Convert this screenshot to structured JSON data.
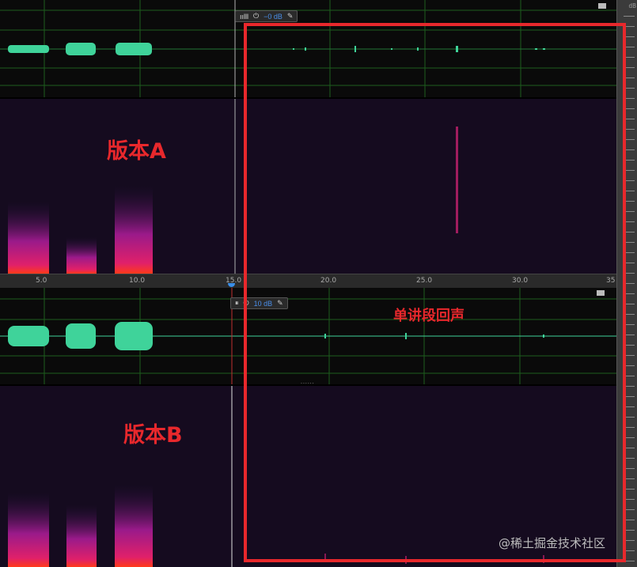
{
  "panels": {
    "a": {
      "label": "版本A",
      "hud_value": "−0 dB"
    },
    "b": {
      "label": "版本B",
      "hud_value": "10 dB"
    }
  },
  "annotation": {
    "label": "单讲段回声"
  },
  "time_ruler": {
    "ticks": [
      "5.0",
      "10.0",
      "15.0",
      "20.0",
      "25.0",
      "30.0",
      "35"
    ]
  },
  "db_ruler": {
    "unit": "dB"
  },
  "watermark": "@稀土掘金技术社区",
  "colors": {
    "annotation": "#e8282c",
    "waveform": "#3fd39a",
    "spectrogram_bg": "#150b1f",
    "grid": "#1f6b1f"
  }
}
